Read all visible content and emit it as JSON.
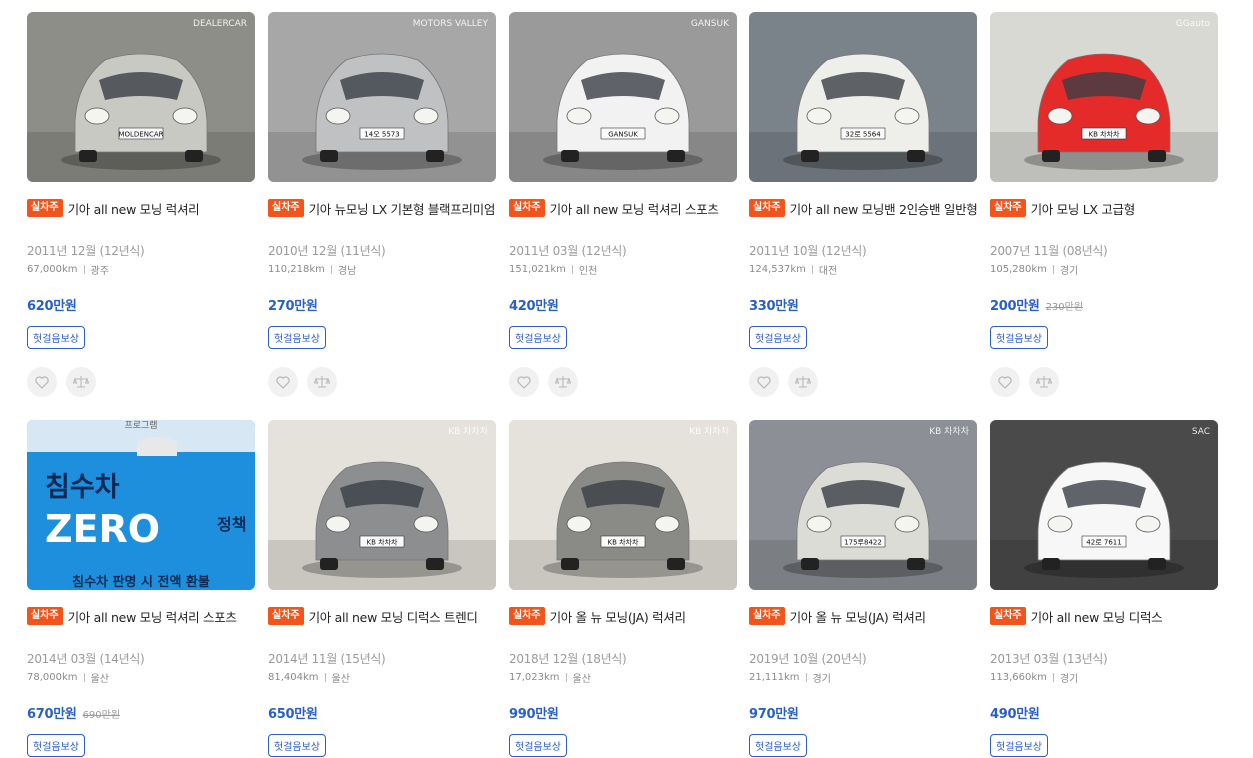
{
  "listings": [
    {
      "badge": "실차주",
      "title": "기아 all new 모닝 럭셔리",
      "year": "2011년 12월 (12년식)",
      "mileage": "67,000km",
      "region": "광주",
      "price": "620만원",
      "old_price": "",
      "guarantee": "헛걸음보상",
      "plate": "MOLDENCAR",
      "car_color": "#c9c9c4",
      "bg": "#8e8e88",
      "watermark": "DEALERCAR"
    },
    {
      "badge": "실차주",
      "title": "기아 뉴모닝 LX 기본형 블랙프리미엄",
      "year": "2010년 12월 (11년식)",
      "mileage": "110,218km",
      "region": "경남",
      "price": "270만원",
      "old_price": "",
      "guarantee": "헛걸음보상",
      "plate": "14오 5573",
      "car_color": "#bfc1c3",
      "bg": "#a7a7a7",
      "watermark": "MOTORS VALLEY"
    },
    {
      "badge": "실차주",
      "title": "기아 all new 모닝 럭셔리 스포츠",
      "year": "2011년 03월 (12년식)",
      "mileage": "151,021km",
      "region": "인천",
      "price": "420만원",
      "old_price": "",
      "guarantee": "헛걸음보상",
      "plate": "GANSUK",
      "car_color": "#f2f2f2",
      "bg": "#9a9a9a",
      "watermark": "GANSUK"
    },
    {
      "badge": "실차주",
      "title": "기아 all new 모닝밴 2인승밴 일반형",
      "year": "2011년 10월 (12년식)",
      "mileage": "124,537km",
      "region": "대전",
      "price": "330만원",
      "old_price": "",
      "guarantee": "헛걸음보상",
      "plate": "32로 5564",
      "car_color": "#eeeeea",
      "bg": "#7a828a",
      "watermark": ""
    },
    {
      "badge": "실차주",
      "title": "기아 모닝 LX 고급형",
      "year": "2007년 11월 (08년식)",
      "mileage": "105,280km",
      "region": "경기",
      "price": "200만원",
      "old_price": "230만원",
      "guarantee": "헛걸음보상",
      "plate": "KB 차차차",
      "car_color": "#e52a2a",
      "bg": "#d9d9d4",
      "watermark": "GGauto"
    },
    {
      "badge": "실차주",
      "title": "기아 all new 모닝 럭셔리 스포츠",
      "year": "2014년 03월 (14년식)",
      "mileage": "78,000km",
      "region": "울산",
      "price": "670만원",
      "old_price": "690만원",
      "guarantee": "헛걸음보상",
      "plate": "",
      "car_color": "#ffffff",
      "bg": "#1a7fd0",
      "watermark": ""
    },
    {
      "badge": "실차주",
      "title": "기아 all new 모닝 디럭스 트렌디",
      "year": "2014년 11월 (15년식)",
      "mileage": "81,404km",
      "region": "울산",
      "price": "650만원",
      "old_price": "",
      "guarantee": "헛걸음보상",
      "plate": "KB 차차차",
      "car_color": "#8d8e8f",
      "bg": "#e4e2da",
      "watermark": "KB 차차차"
    },
    {
      "badge": "실차주",
      "title": "기아 올 뉴 모닝(JA) 럭셔리",
      "year": "2018년 12월 (18년식)",
      "mileage": "17,023km",
      "region": "울산",
      "price": "990만원",
      "old_price": "",
      "guarantee": "헛걸음보상",
      "plate": "KB 차차차",
      "car_color": "#8a8a86",
      "bg": "#e4e2da",
      "watermark": "KB 차차차"
    },
    {
      "badge": "실차주",
      "title": "기아 올 뉴 모닝(JA) 럭셔리",
      "year": "2019년 10월 (20년식)",
      "mileage": "21,111km",
      "region": "경기",
      "price": "970만원",
      "old_price": "",
      "guarantee": "헛걸음보상",
      "plate": "175루8422",
      "car_color": "#dcdcd6",
      "bg": "#8c9096",
      "watermark": "KB 차차차"
    },
    {
      "badge": "실차주",
      "title": "기아 all new 모닝 디럭스",
      "year": "2013년 03월 (13년식)",
      "mileage": "113,660km",
      "region": "경기",
      "price": "490만원",
      "old_price": "",
      "guarantee": "헛걸음보상",
      "plate": "42로 7611",
      "car_color": "#f7f7f7",
      "bg": "#4a4a4a",
      "watermark": "SAC"
    }
  ],
  "promo": {
    "line1": "침수차",
    "line2": "ZERO",
    "side": "정책",
    "bottom": "침수차 판명 시 전액 환불",
    "top": "프로그램"
  },
  "icons": {
    "like": "heart-icon",
    "compare": "scale-icon"
  }
}
